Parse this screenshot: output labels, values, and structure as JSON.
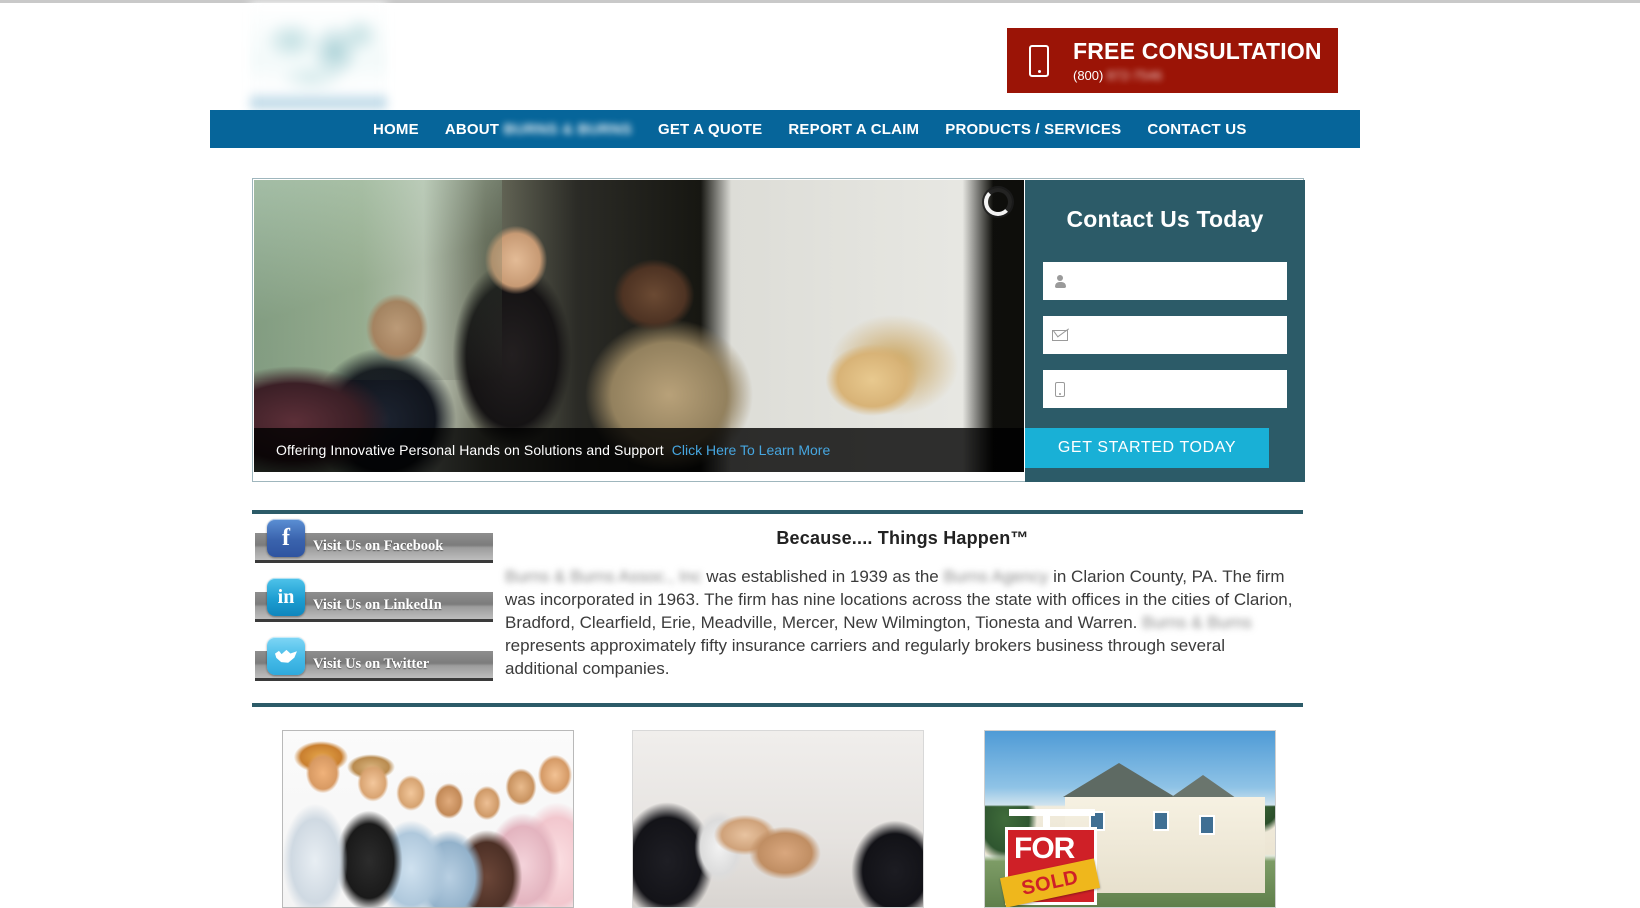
{
  "header": {
    "logo_alt": "company-logo",
    "free_consultation": {
      "title": "FREE CONSULTATION",
      "phone_prefix": "(800)",
      "phone_rest": "872-7546",
      "icon": "mobile-phone-icon"
    }
  },
  "nav": {
    "items": [
      {
        "label": "HOME",
        "brand": ""
      },
      {
        "label": "ABOUT",
        "brand": "BURNS & BURNS"
      },
      {
        "label": "GET A QUOTE",
        "brand": ""
      },
      {
        "label": "REPORT A CLAIM",
        "brand": ""
      },
      {
        "label": "PRODUCTS / SERVICES",
        "brand": ""
      },
      {
        "label": "CONTACT US",
        "brand": ""
      }
    ]
  },
  "hero": {
    "spinner_icon": "loading-spinner-icon",
    "caption_text": "Offering Innovative Personal Hands on Solutions and Support",
    "caption_link": "Click Here To Learn More"
  },
  "contact_form": {
    "title": "Contact Us Today",
    "fields": [
      {
        "icon": "person-icon",
        "value": "",
        "placeholder": ""
      },
      {
        "icon": "envelope-icon",
        "value": "",
        "placeholder": ""
      },
      {
        "icon": "mobile-phone-icon",
        "value": "",
        "placeholder": ""
      }
    ],
    "submit_label": "GET STARTED TODAY"
  },
  "socials": [
    {
      "label": "Visit Us on Facebook",
      "icon": "facebook-icon",
      "glyph": "f"
    },
    {
      "label": "Visit Us on LinkedIn",
      "icon": "linkedin-icon",
      "glyph": "in"
    },
    {
      "label": "Visit Us on Twitter",
      "icon": "twitter-icon",
      "glyph": ""
    }
  ],
  "main": {
    "tagline": "Because.... Things Happen™",
    "paragraph": {
      "p1_brand": "Burns & Burns Assoc., Inc",
      "p1_a": " was established in 1939 as the ",
      "p2_brand": "Burns Agency",
      "p1_b": " in Clarion County, PA. The firm was incorporated in 1963. The firm has nine locations across the state with offices in the cities of Clarion, Bradford, Clearfield, Erie, Meadville, Mercer, New Wilmington, Tionesta and Warren. ",
      "p3_brand": "Burns & Burns",
      "p1_c": " represents approximately fifty insurance carriers and regularly brokers business through several additional companies."
    }
  },
  "cards": [
    {
      "name": "team-photo",
      "alt": "Group of business professionals"
    },
    {
      "name": "handshake-photo",
      "alt": "Two people shaking hands"
    },
    {
      "name": "house-sold-photo",
      "alt": "House with FOR SALE SOLD sign",
      "sign_for": "FOR",
      "sign_sold": "SOLD"
    }
  ],
  "colors": {
    "nav_blue": "#06659a",
    "accent_red": "#9b1406",
    "panel_teal": "#2c5b68",
    "button_cyan": "#19b0d6",
    "link_blue": "#46a6e0"
  }
}
